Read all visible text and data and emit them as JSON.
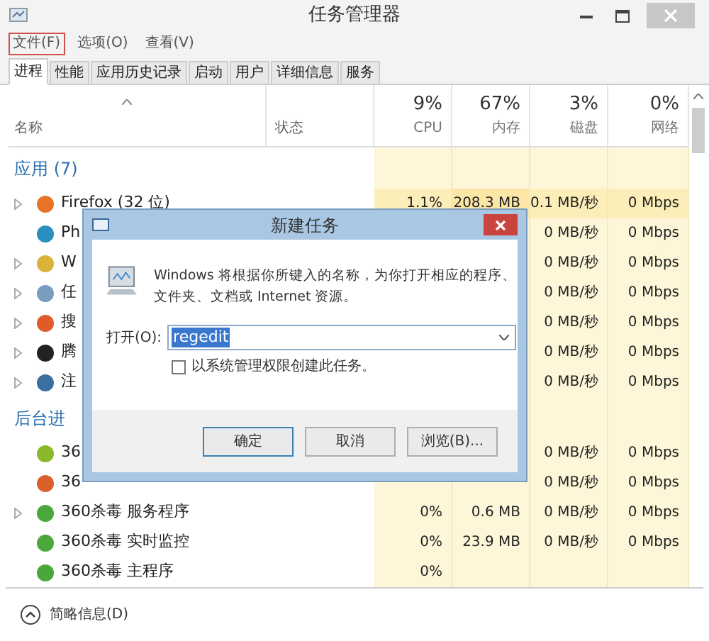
{
  "window": {
    "title": "任务管理器"
  },
  "menu": [
    {
      "label": "文件(F)",
      "highlighted": true
    },
    {
      "label": "选项(O)",
      "highlighted": false
    },
    {
      "label": "查看(V)",
      "highlighted": false
    }
  ],
  "tabs": [
    {
      "label": "进程",
      "selected": true
    },
    {
      "label": "性能",
      "selected": false
    },
    {
      "label": "应用历史记录",
      "selected": false
    },
    {
      "label": "启动",
      "selected": false
    },
    {
      "label": "用户",
      "selected": false
    },
    {
      "label": "详细信息",
      "selected": false
    },
    {
      "label": "服务",
      "selected": false
    }
  ],
  "columns": {
    "name": "名称",
    "status": "状态",
    "metrics": [
      {
        "percent": "9%",
        "label": "CPU"
      },
      {
        "percent": "67%",
        "label": "内存"
      },
      {
        "percent": "3%",
        "label": "磁盘"
      },
      {
        "percent": "0%",
        "label": "网络"
      }
    ]
  },
  "groups": [
    {
      "title": "应用 (7)",
      "rows": [
        {
          "name": "Firefox (32 位)",
          "expandable": true,
          "color": "#e8742a",
          "cells": [
            "1.1%",
            "208.3 MB",
            "0.1 MB/秒",
            "0 Mbps"
          ]
        },
        {
          "name": "Ph",
          "expandable": false,
          "color": "#2a8fbf",
          "cells": [
            null,
            null,
            "0 MB/秒",
            "0 Mbps"
          ]
        },
        {
          "name": "W",
          "expandable": true,
          "color": "#d9b33a",
          "cells": [
            null,
            null,
            "0 MB/秒",
            "0 Mbps"
          ]
        },
        {
          "name": "任",
          "expandable": true,
          "color": "#7a9cc0",
          "cells": [
            null,
            null,
            "0 MB/秒",
            "0 Mbps"
          ]
        },
        {
          "name": "搜",
          "expandable": true,
          "color": "#e05a2a",
          "cells": [
            null,
            null,
            "0 MB/秒",
            "0 Mbps"
          ]
        },
        {
          "name": "腾",
          "expandable": true,
          "color": "#222222",
          "cells": [
            null,
            null,
            "0 MB/秒",
            "0 Mbps"
          ]
        },
        {
          "name": "注",
          "expandable": true,
          "color": "#3a6fa0",
          "cells": [
            null,
            null,
            "0 MB/秒",
            "0 Mbps"
          ]
        }
      ]
    },
    {
      "title": "后台进",
      "rows": [
        {
          "name": "36",
          "expandable": false,
          "color": "#8ab82a",
          "cells": [
            null,
            null,
            "0 MB/秒",
            "0 Mbps"
          ]
        },
        {
          "name": "36",
          "expandable": false,
          "color": "#d9602a",
          "cells": [
            null,
            null,
            "0 MB/秒",
            "0 Mbps"
          ]
        },
        {
          "name": "360杀毒 服务程序",
          "expandable": true,
          "color": "#4aa83a",
          "cells": [
            "0%",
            "0.6 MB",
            "0 MB/秒",
            "0 Mbps"
          ]
        },
        {
          "name": "360杀毒 实时监控",
          "expandable": false,
          "color": "#4aa83a",
          "cells": [
            "0%",
            "23.9 MB",
            "0 MB/秒",
            "0 Mbps"
          ]
        },
        {
          "name": "360杀毒 主程序",
          "expandable": false,
          "color": "#4aa83a",
          "cells": [
            "0%",
            null,
            null,
            null
          ]
        }
      ]
    }
  ],
  "footer": {
    "label": "简略信息(D)"
  },
  "dialog": {
    "title": "新建任务",
    "message": "Windows 将根据你所键入的名称，为你打开相应的程序、文件夹、文档或 Internet 资源。",
    "open_label": "打开(O):",
    "open_value": "regedit",
    "checkbox": {
      "label": "以系统管理权限创建此任务。",
      "checked": false
    },
    "buttons": [
      {
        "label": "确定",
        "default": true
      },
      {
        "label": "取消",
        "default": false
      },
      {
        "label": "浏览(B)...",
        "default": false
      }
    ]
  }
}
